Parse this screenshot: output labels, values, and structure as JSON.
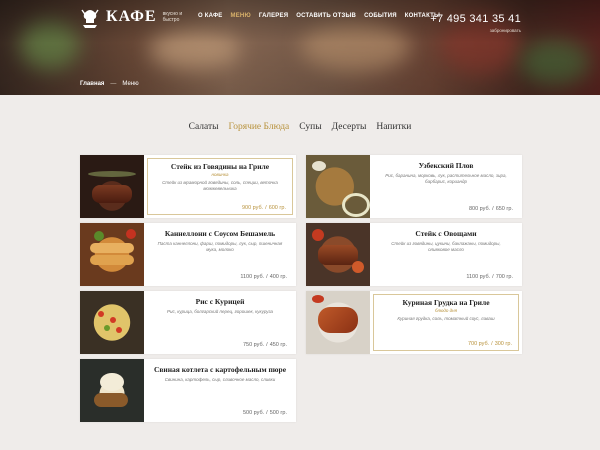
{
  "brand": {
    "title": "КАФЕ",
    "tagline": "вкусно и быстро"
  },
  "nav": {
    "items": [
      {
        "label": "О кафе",
        "active": false
      },
      {
        "label": "Меню",
        "active": true
      },
      {
        "label": "Галерея",
        "active": false
      },
      {
        "label": "Оставить отзыв",
        "active": false
      },
      {
        "label": "События",
        "active": false
      },
      {
        "label": "Контакты",
        "active": false
      }
    ]
  },
  "contact": {
    "phone": "+7 495 341 35 41",
    "action": "забронировать"
  },
  "breadcrumb": {
    "home": "Главная",
    "separator": "—",
    "current": "Меню"
  },
  "tabs": [
    {
      "label": "Салаты",
      "active": false
    },
    {
      "label": "Горячие Блюда",
      "active": true
    },
    {
      "label": "Супы",
      "active": false
    },
    {
      "label": "Десерты",
      "active": false
    },
    {
      "label": "Напитки",
      "active": false
    }
  ],
  "colors": {
    "accent": "#b8923c",
    "background": "#efecea",
    "card": "#ffffff"
  },
  "menu_items": [
    {
      "title": "Стейк из Говядины на Гриле",
      "subtitle": "новинка",
      "description": "Стейк из мраморной говядины, соль, специи, веточка можжевельника",
      "price": "900 руб.",
      "weight": "600 гр.",
      "photo": "steak-photo",
      "highlighted": true
    },
    {
      "title": "Узбекский Плов",
      "subtitle": "",
      "description": "Рис, баранина, морковь, лук, растительное масло, зира, барбарис, кориандр",
      "price": "800 руб.",
      "weight": "650 гр.",
      "photo": "plov-photo",
      "highlighted": false
    },
    {
      "title": "Каннеллони с Соусом Бешамель",
      "subtitle": "",
      "description": "Паста каннеллони, фарш, помидоры, лук, сыр, пшеничная мука, молоко",
      "price": "1100 руб.",
      "weight": "400 гр.",
      "photo": "cannelloni-photo",
      "highlighted": false
    },
    {
      "title": "Стейк с Овощами",
      "subtitle": "",
      "description": "Стейк из говядины, цукини, баклажаны, помидоры, оливковое масло",
      "price": "1100 руб.",
      "weight": "700 гр.",
      "photo": "steak-vegetables-photo",
      "highlighted": false
    },
    {
      "title": "Рис с Курицей",
      "subtitle": "",
      "description": "Рис, курица, болгарский перец, горошек, кукуруза",
      "price": "750 руб.",
      "weight": "450 гр.",
      "photo": "rice-chicken-photo",
      "highlighted": false
    },
    {
      "title": "Куриная Грудка на Гриле",
      "subtitle": "блюдо дня",
      "description": "Куриная грудка, соль, томатный соус, лаваш",
      "price": "700 руб.",
      "weight": "300 гр.",
      "photo": "chicken-breast-photo",
      "highlighted": true
    },
    {
      "title": "Свиная котлета с картофельным пюре",
      "subtitle": "",
      "description": "Свинина, картофель, сыр, сливочное масло, сливки",
      "price": "500 руб.",
      "weight": "500 гр.",
      "photo": "cutlet-photo",
      "highlighted": false
    }
  ]
}
